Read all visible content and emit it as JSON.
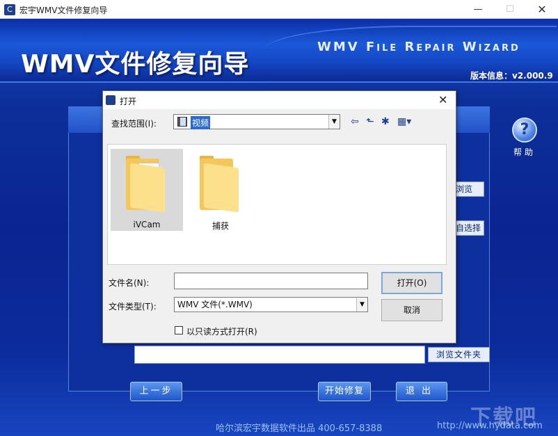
{
  "window": {
    "title": "宏宇WMV文件修复向导",
    "min_glyph": "—",
    "max_glyph": "☐",
    "close_glyph": "✕"
  },
  "app": {
    "title_cn": "WMV文件修复向导",
    "title_en": "WMV File Repair Wizard",
    "version": "版本信息：v2.000.9",
    "help_glyph": "?",
    "help_label": "帮助",
    "side_buttons": [
      "浏览",
      "自选择"
    ],
    "browse_folder": "浏览文件夹",
    "prev_button": "上一步",
    "start_button": "开始修复",
    "exit_button": "退出",
    "footer": "哈尔滨宏宇数据软件出品  400-657-8388",
    "footer_url": "http://www.hydata.com",
    "watermark": "下载吧"
  },
  "dialog": {
    "title": "打开",
    "close_glyph": "✕",
    "look_in_label": "查找范围(I):",
    "look_in_value": "视频",
    "files": [
      {
        "name": "iVCam",
        "selected": true
      },
      {
        "name": "捕获",
        "selected": false
      }
    ],
    "filename_label": "文件名(N):",
    "filename_value": "",
    "filetype_label": "文件类型(T):",
    "filetype_value": "WMV 文件(*.WMV)",
    "open_button": "打开(O)",
    "cancel_button": "取消",
    "readonly_label": "以只读方式打开(R)",
    "readonly_checked": false,
    "toolbar_icons": [
      "back-icon",
      "up-folder-icon",
      "new-folder-icon",
      "view-menu-icon"
    ]
  }
}
